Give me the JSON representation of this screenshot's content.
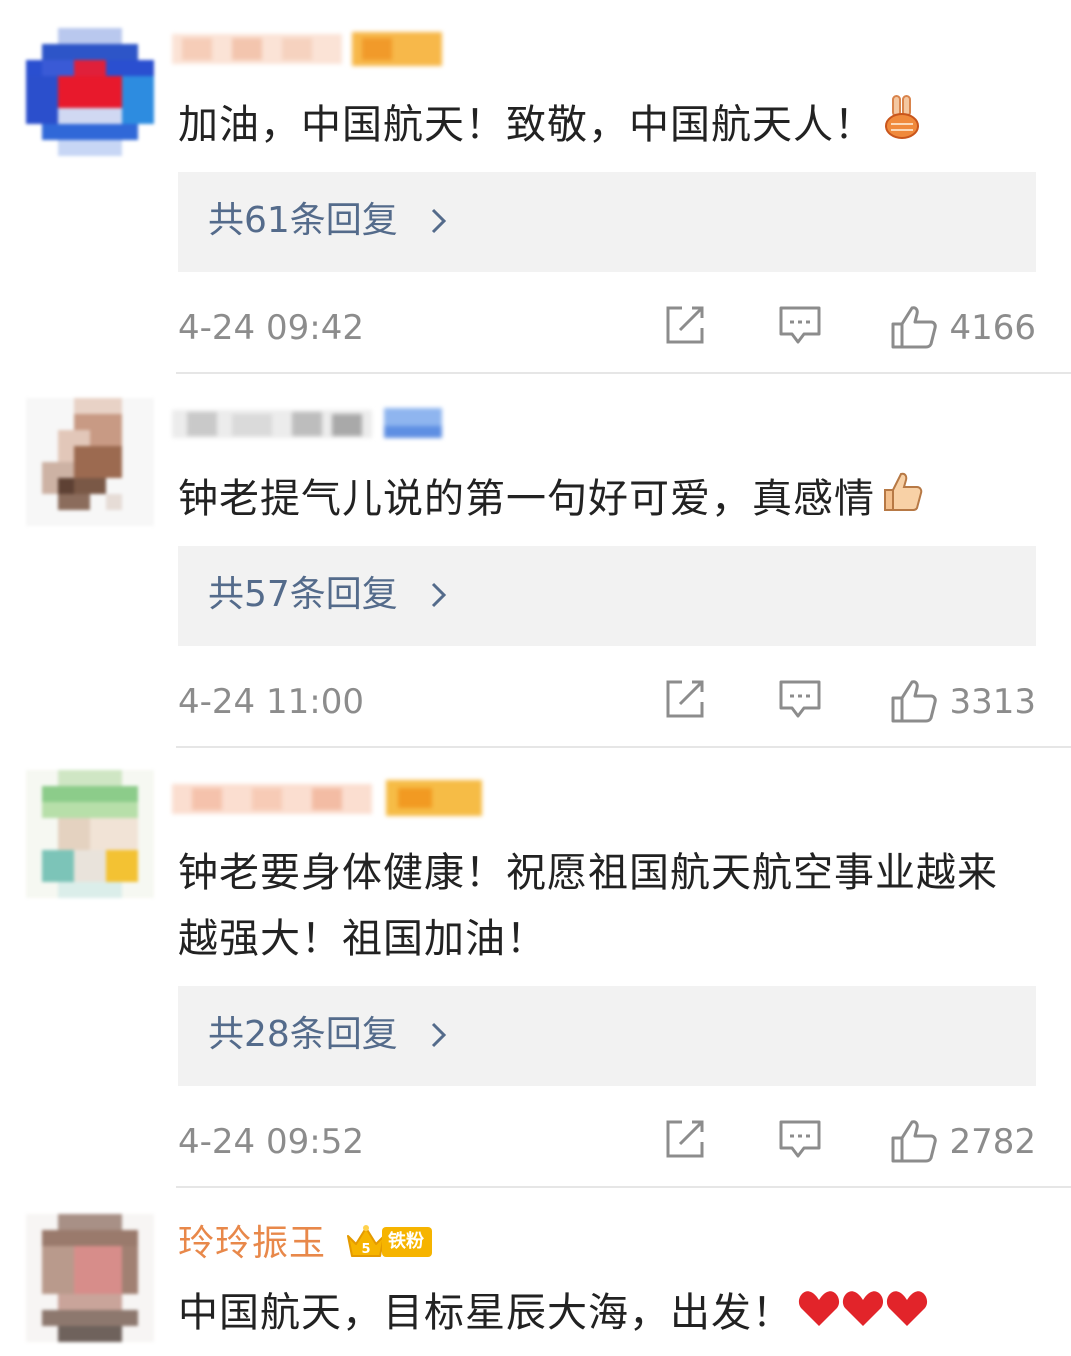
{
  "comments": [
    {
      "username": "",
      "text": "加油，中国航天！致敬，中国航天人！",
      "emoji_icon": "victory-hand-emoji-icon",
      "replies_label": "共61条回复",
      "timestamp": "4-24 09:42",
      "likes": "4166"
    },
    {
      "username": "",
      "text": "钟老提气儿说的第一句好可爱，真感情",
      "emoji_icon": "thumbs-up-emoji-icon",
      "replies_label": "共57条回复",
      "timestamp": "4-24 11:00",
      "likes": "3313"
    },
    {
      "username": "",
      "text": "钟老要身体健康！祝愿祖国航天航空事业越来越强大！祖国加油！",
      "emoji_icon": "",
      "replies_label": "共28条回复",
      "timestamp": "4-24 09:52",
      "likes": "2782"
    },
    {
      "username": "玲玲振玉",
      "fan_badge": "铁粉",
      "fan_level": "5",
      "text": "中国航天，目标星辰大海，出发！",
      "emoji_icon": "red-heart-emoji-icon",
      "replies_label": "",
      "timestamp": "",
      "likes": ""
    }
  ],
  "colors": {
    "reply_link": "#546b8b",
    "meta_gray": "#8c8c8c",
    "username_orange": "#e8884a",
    "reply_box_bg": "#f2f2f2",
    "badge_gold": "#f6b400"
  },
  "icons": [
    "share-icon",
    "comment-icon",
    "like-icon",
    "chevron-right-icon"
  ]
}
